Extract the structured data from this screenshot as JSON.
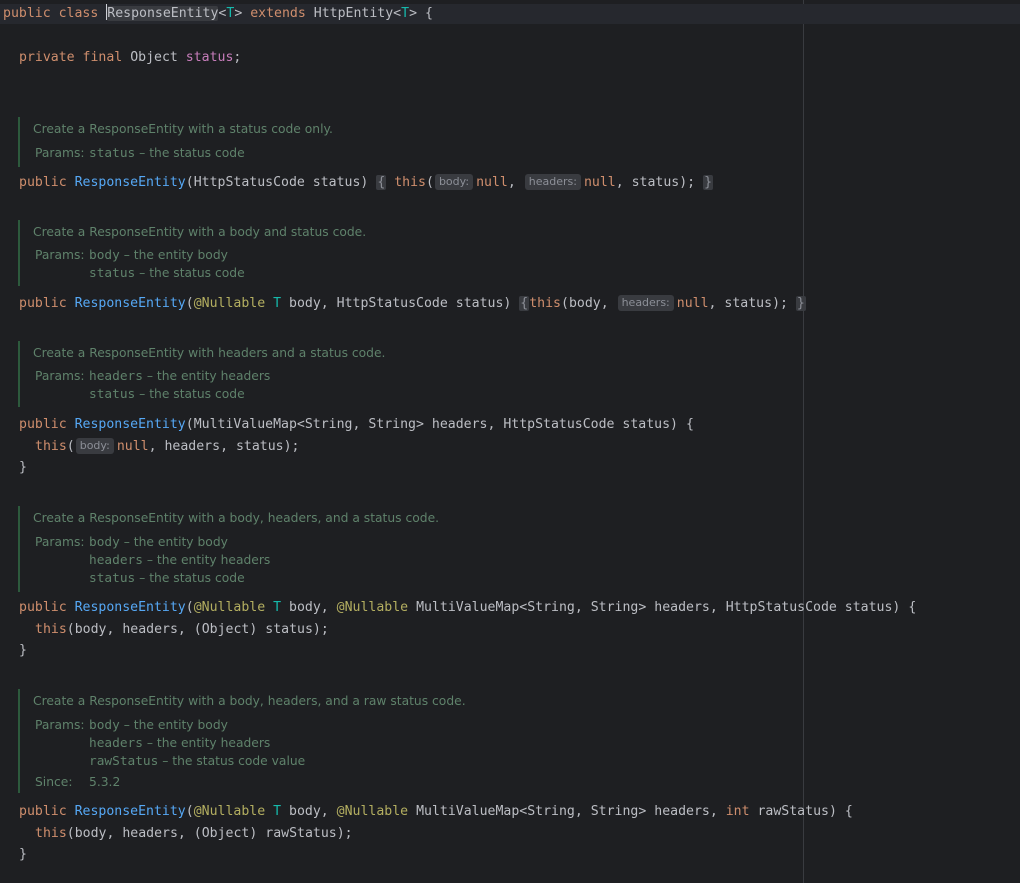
{
  "header": {
    "kw_public": "public",
    "kw_class": "class",
    "class_name": "ResponseEntity",
    "type_open": "<",
    "type_param": "T",
    "type_close": ">",
    "kw_extends": "extends",
    "parent": "HttpEntity",
    "brace": "{"
  },
  "field": {
    "kw1": "private",
    "kw2": "final",
    "type": "Object",
    "name": "status",
    "semi": ";"
  },
  "docs": [
    {
      "desc": "Create a ResponseEntity with a status code only.",
      "params_label": "Params:",
      "params": [
        {
          "name": "status",
          "text": " – the status code"
        }
      ]
    },
    {
      "desc": "Create a ResponseEntity with a body and status code.",
      "params_label": "Params:",
      "params": [
        {
          "name": "body",
          "text": " – the entity body"
        },
        {
          "name": "status",
          "text": " – the status code"
        }
      ]
    },
    {
      "desc": "Create a ResponseEntity with headers and a status code.",
      "params_label": "Params:",
      "params": [
        {
          "name": "headers",
          "text": " – the entity headers"
        },
        {
          "name": "status",
          "text": " – the status code"
        }
      ]
    },
    {
      "desc": "Create a ResponseEntity with a body, headers, and a status code.",
      "params_label": "Params:",
      "params": [
        {
          "name": "body",
          "text": " – the entity body"
        },
        {
          "name": "headers",
          "text": " – the entity headers"
        },
        {
          "name": "status",
          "text": " – the status code"
        }
      ]
    },
    {
      "desc": "Create a ResponseEntity with a body, headers, and a raw status code.",
      "params_label": "Params:",
      "params": [
        {
          "name": "body",
          "text": " – the entity body"
        },
        {
          "name": "headers",
          "text": " – the entity headers"
        },
        {
          "name": "rawStatus",
          "text": " – the status code value"
        }
      ],
      "since_label": "Since:",
      "since_value": "5.3.2"
    }
  ],
  "ctor1": {
    "kw": "public",
    "name": "ResponseEntity",
    "params": "(HttpStatusCode status)",
    "fold_open": "{",
    "this": "this",
    "paren": "(",
    "hint_body": "body:",
    "null1": "null",
    "comma1": ", ",
    "hint_headers": "headers:",
    "null2": "null",
    "rest": ", status);",
    "fold_close": "}"
  },
  "ctor2": {
    "kw": "public",
    "name": "ResponseEntity",
    "p_open": "(",
    "ann": "@Nullable",
    "tp": "T",
    "params_rest": " body, HttpStatusCode status)",
    "fold_open": "{",
    "this": "this",
    "args1": "(body, ",
    "hint_headers": "headers:",
    "null1": "null",
    "rest": ", status);",
    "fold_close": "}"
  },
  "ctor3": {
    "kw": "public",
    "name": "ResponseEntity",
    "params": "(MultiValueMap<String, String> headers, HttpStatusCode status) {",
    "this": "this",
    "paren": "(",
    "hint_body": "body:",
    "null1": "null",
    "rest": ", headers, status);",
    "close": "}"
  },
  "ctor4": {
    "kw": "public",
    "name": "ResponseEntity",
    "p_open": "(",
    "ann1": "@Nullable",
    "tp": "T",
    "mid": " body, ",
    "ann2": "@Nullable",
    "rest": " MultiValueMap<String, String> headers, HttpStatusCode status) {",
    "this": "this",
    "body": "(body, headers, (Object) status);",
    "close": "}"
  },
  "ctor5": {
    "kw": "public",
    "name": "ResponseEntity",
    "p_open": "(",
    "ann1": "@Nullable",
    "tp": "T",
    "mid": " body, ",
    "ann2": "@Nullable",
    "rest1": " MultiValueMap<String, String> headers, ",
    "kw_int": "int",
    "rest2": " rawStatus) {",
    "this": "this",
    "body": "(body, headers, (Object) rawStatus);",
    "close": "}"
  }
}
